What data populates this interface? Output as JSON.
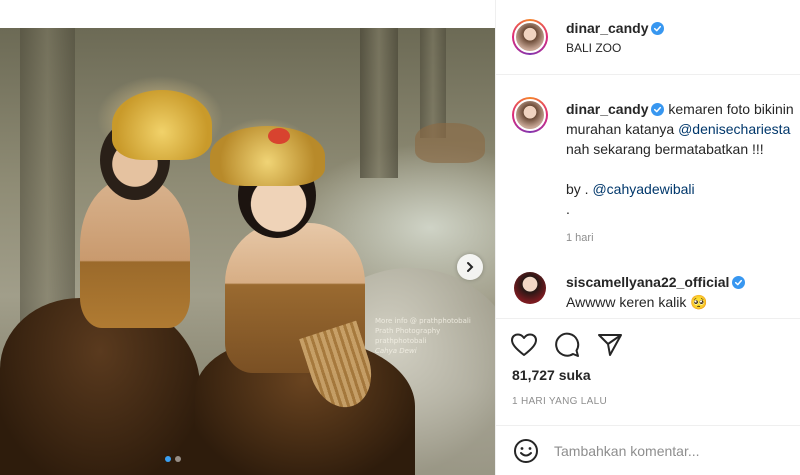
{
  "post": {
    "author": "dinar_candy",
    "location": "BALI ZOO",
    "caption_lines": [
      "kemaren foto bikinin",
      "murahan katanya",
      "nah sekarang bermatabatkan !!!",
      "by .",
      "."
    ],
    "caption_mentions": [
      "@denisechariesta",
      "@cahyadewibali"
    ],
    "time_ago": "1 hari",
    "likes": "81,727 suka",
    "date": "1 HARI YANG LALU"
  },
  "photo": {
    "watermark_lines": [
      "More info @ prathphotobali",
      "Prath Photography",
      "prathphotobali",
      "Cahya Dewi"
    ]
  },
  "comment": {
    "author": "siscamellyana22_official",
    "text": "Awwww keren kalik 🥺"
  },
  "add_comment": {
    "placeholder": "Tambahkan komentar..."
  },
  "icons": {
    "like": "heart-icon",
    "comment": "comment-bubble-icon",
    "share": "paper-plane-icon",
    "next": "chevron-right-icon",
    "emoji": "smiley-icon",
    "verified": "verified-badge-icon"
  },
  "colors": {
    "verified": "#3897f0",
    "mention": "#00376b",
    "muted": "#8e8e8e"
  }
}
